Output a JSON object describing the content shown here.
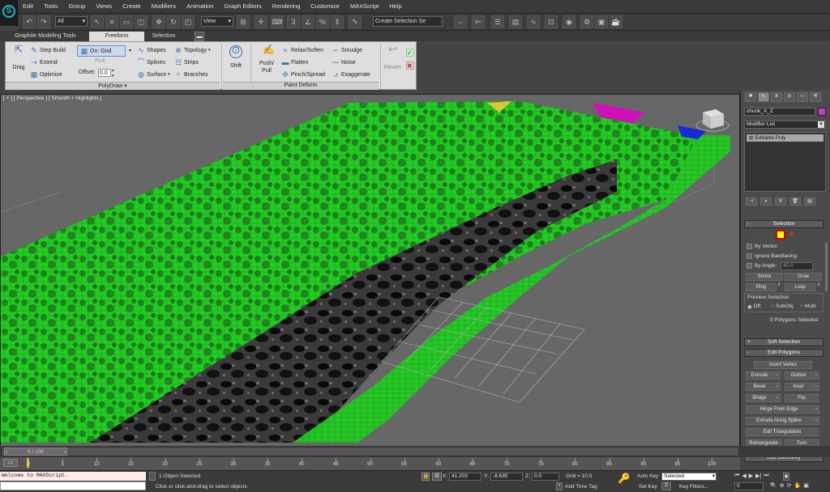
{
  "menubar": {
    "items": [
      "Edit",
      "Tools",
      "Group",
      "Views",
      "Create",
      "Modifiers",
      "Animation",
      "Graph Editors",
      "Rendering",
      "Customize",
      "MAXScript",
      "Help"
    ]
  },
  "toolbar": {
    "filter_value": "All",
    "refcoord_value": "View",
    "selection_set_placeholder": "Create Selection Se"
  },
  "ribbon": {
    "tabs": [
      "Graphite Modeling Tools",
      "Freeform",
      "Selection"
    ],
    "active_tab": "Freeform",
    "polydraw": {
      "title": "PolyDraw",
      "drag": "Drag",
      "step_build": "Step Build",
      "extend": "Extend",
      "optimize": "Optimize",
      "on_grid": "On: Grid",
      "pick": "Pick",
      "offset_label": "Offset:",
      "offset_value": "0.0",
      "shapes": "Shapes",
      "splines": "Splines",
      "surface": "Surface",
      "topology": "Topology",
      "strips": "Strips",
      "branches": "Branches"
    },
    "shift": "Shift",
    "paint_deform": {
      "title": "Paint Deform",
      "push_pull_1": "Push/",
      "push_pull_2": "Pull",
      "relax_soften": "Relax/Soften",
      "flatten": "Flatten",
      "pinch_spread": "Pinch/Spread",
      "smudge": "Smudge",
      "noise": "Noise",
      "exaggerate": "Exaggerate",
      "revert": "Revert"
    }
  },
  "viewport": {
    "label": "[ + ] [ Perspective ] [ Smooth + Highlights ]"
  },
  "command_panel": {
    "object_name": "chunk_X_Z",
    "object_color": "#c83cc8",
    "modifier_list": "Modifier List",
    "stack_item": "Editable Poly",
    "selection": {
      "title": "Selection",
      "by_vertex": "By Vertex",
      "ignore_backfacing": "Ignore Backfacing",
      "by_angle": "By Angle:",
      "angle_value": "45.0",
      "shrink": "Shrink",
      "grow": "Grow",
      "ring": "Ring",
      "loop": "Loop",
      "preview_selection": "Preview Selection",
      "off": "Off",
      "subobj": "SubObj",
      "multi": "Multi",
      "status": "0 Polygons Selected"
    },
    "soft_selection": "Soft Selection",
    "edit_polygons": {
      "title": "Edit Polygons",
      "insert_vertex": "Insert Vertex",
      "extrude": "Extrude",
      "outline": "Outline",
      "bevel": "Bevel",
      "inset": "Inset",
      "bridge": "Bridge",
      "flip": "Flip",
      "hinge_from_edge": "Hinge From Edge",
      "extrude_along_spline": "Extrude Along Spline",
      "edit_triangulation": "Edit Triangulation",
      "retriangulate": "Retriangulate",
      "turn": "Turn"
    },
    "edit_geometry": "Edit Geometry"
  },
  "timeline": {
    "frame_display": "0 / 100",
    "ticks": [
      "0",
      "5",
      "10",
      "15",
      "20",
      "25",
      "30",
      "35",
      "40",
      "45",
      "50",
      "55",
      "60",
      "65",
      "70",
      "75",
      "80",
      "85",
      "90",
      "95",
      "100"
    ]
  },
  "status": {
    "maxscript_listener": "Welcome to MAXScript.",
    "objects_selected": "1 Object Selected",
    "prompt": "Click or click-and-drag to select objects",
    "x_label": "X:",
    "x_value": "41.203",
    "y_label": "Y:",
    "y_value": "-8.635",
    "z_label": "Z:",
    "z_value": "0.0",
    "grid": "Grid = 10.0",
    "add_time_tag": "Add Time Tag",
    "auto_key": "Auto Key",
    "set_key": "Set Key",
    "key_mode_value": "Selected",
    "key_filters": "Key Filters...",
    "current_frame": "0"
  }
}
